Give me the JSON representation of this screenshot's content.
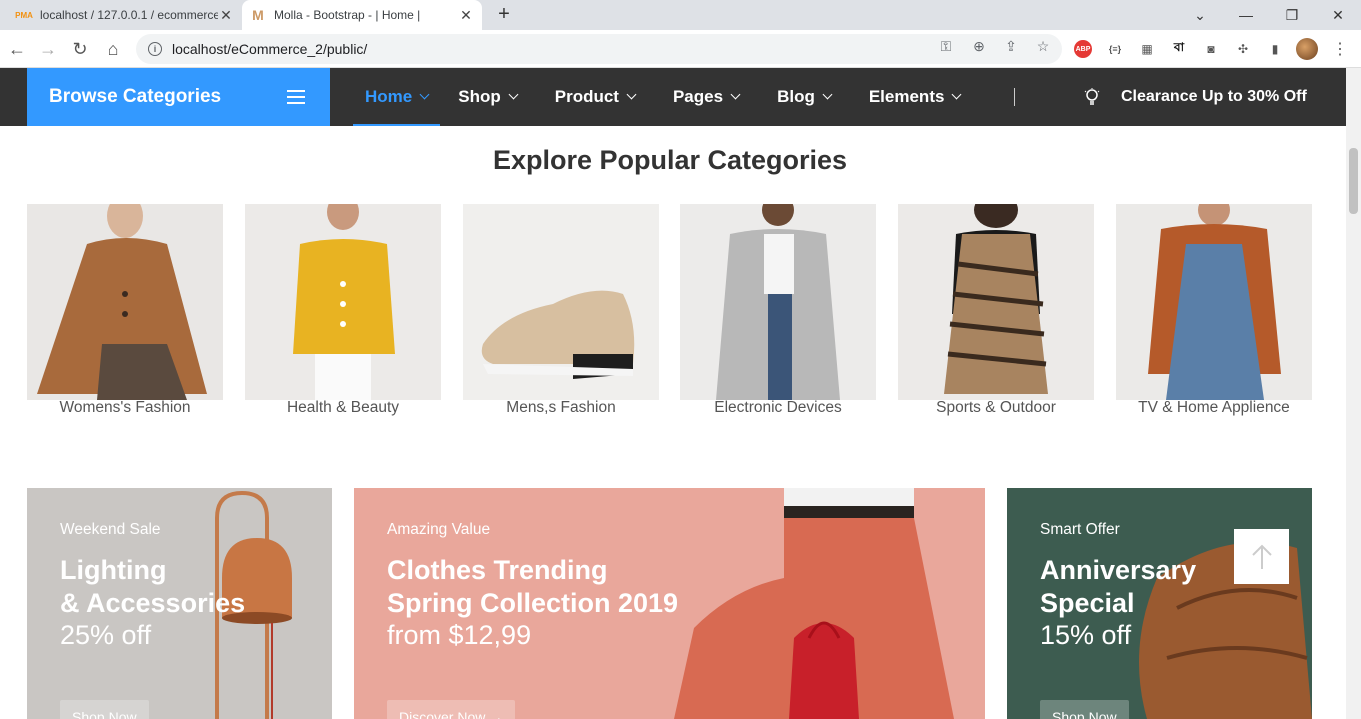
{
  "browser": {
    "tabs": [
      {
        "title": "localhost / 127.0.0.1 / ecommerce",
        "favicon": "phpmyadmin-icon"
      },
      {
        "title": "Molla - Bootstrap - | Home |",
        "favicon": "molla-icon"
      }
    ],
    "url": "localhost/eCommerce_2/public/",
    "ext_badge": "ABP",
    "json_ext": "{≡}",
    "bangla_ext": "বা"
  },
  "nav": {
    "browse_label": "Browse Categories",
    "menu": [
      "Home",
      "Shop",
      "Product",
      "Pages",
      "Blog",
      "Elements"
    ],
    "clearance": "Clearance Up to 30% Off"
  },
  "categories": {
    "title": "Explore Popular Categories",
    "items": [
      "Womens's Fashion",
      "Health & Beauty",
      "Mens,s Fashion",
      "Electronic Devices",
      "Sports & Outdoor",
      "TV & Home Applience"
    ]
  },
  "banners": [
    {
      "sub": "Weekend Sale",
      "title1": "Lighting",
      "title2": "& Accessories",
      "price": "25% off",
      "button": "Shop Now"
    },
    {
      "sub": "Amazing Value",
      "title1": "Clothes Trending",
      "title2": "Spring Collection 2019",
      "price": "from $12,99",
      "button": "Discover Now"
    },
    {
      "sub": "Smart Offer",
      "title1": "Anniversary",
      "title2": "Special",
      "price": "15% off",
      "button": "Shop Now"
    }
  ],
  "colors": {
    "accent": "#3399ff",
    "nav_bg": "#333333"
  }
}
